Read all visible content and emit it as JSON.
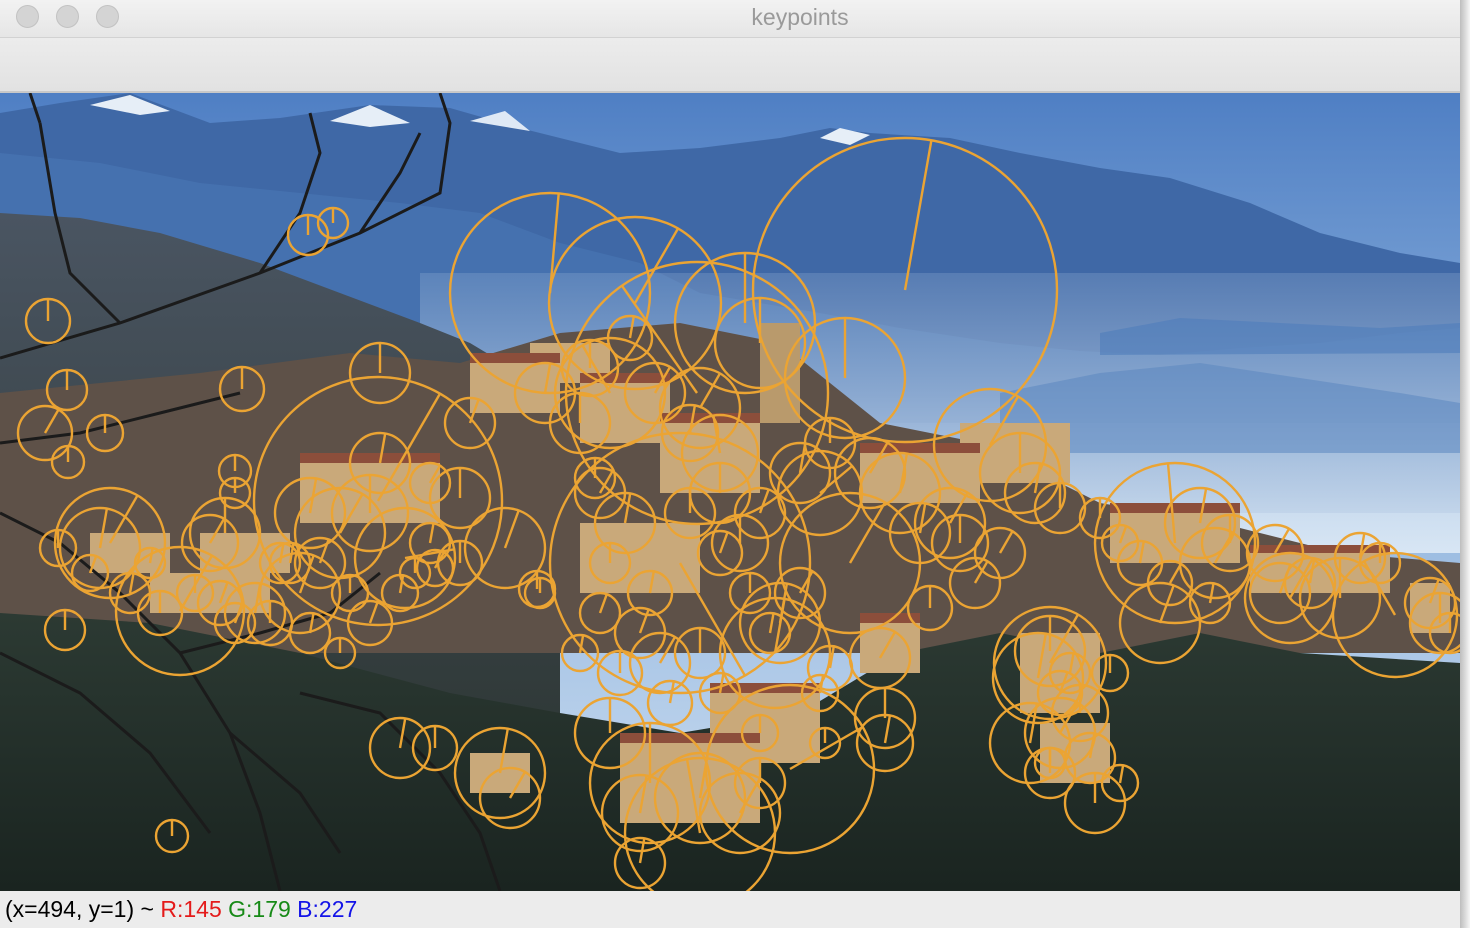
{
  "window": {
    "title": "keypoints"
  },
  "status": {
    "coords": "(x=494, y=1)",
    "separator": "~",
    "r_label": "R:145",
    "g_label": "G:179",
    "b_label": "B:227"
  },
  "colors": {
    "keypoint": "#eba433",
    "sky": "#5f8fcf",
    "r_text": "#e41b1b",
    "g_text": "#178a17",
    "b_text": "#1414e8"
  },
  "icons": {
    "close": "traffic-light-close",
    "minimize": "traffic-light-minimize",
    "zoom": "traffic-light-zoom"
  }
}
